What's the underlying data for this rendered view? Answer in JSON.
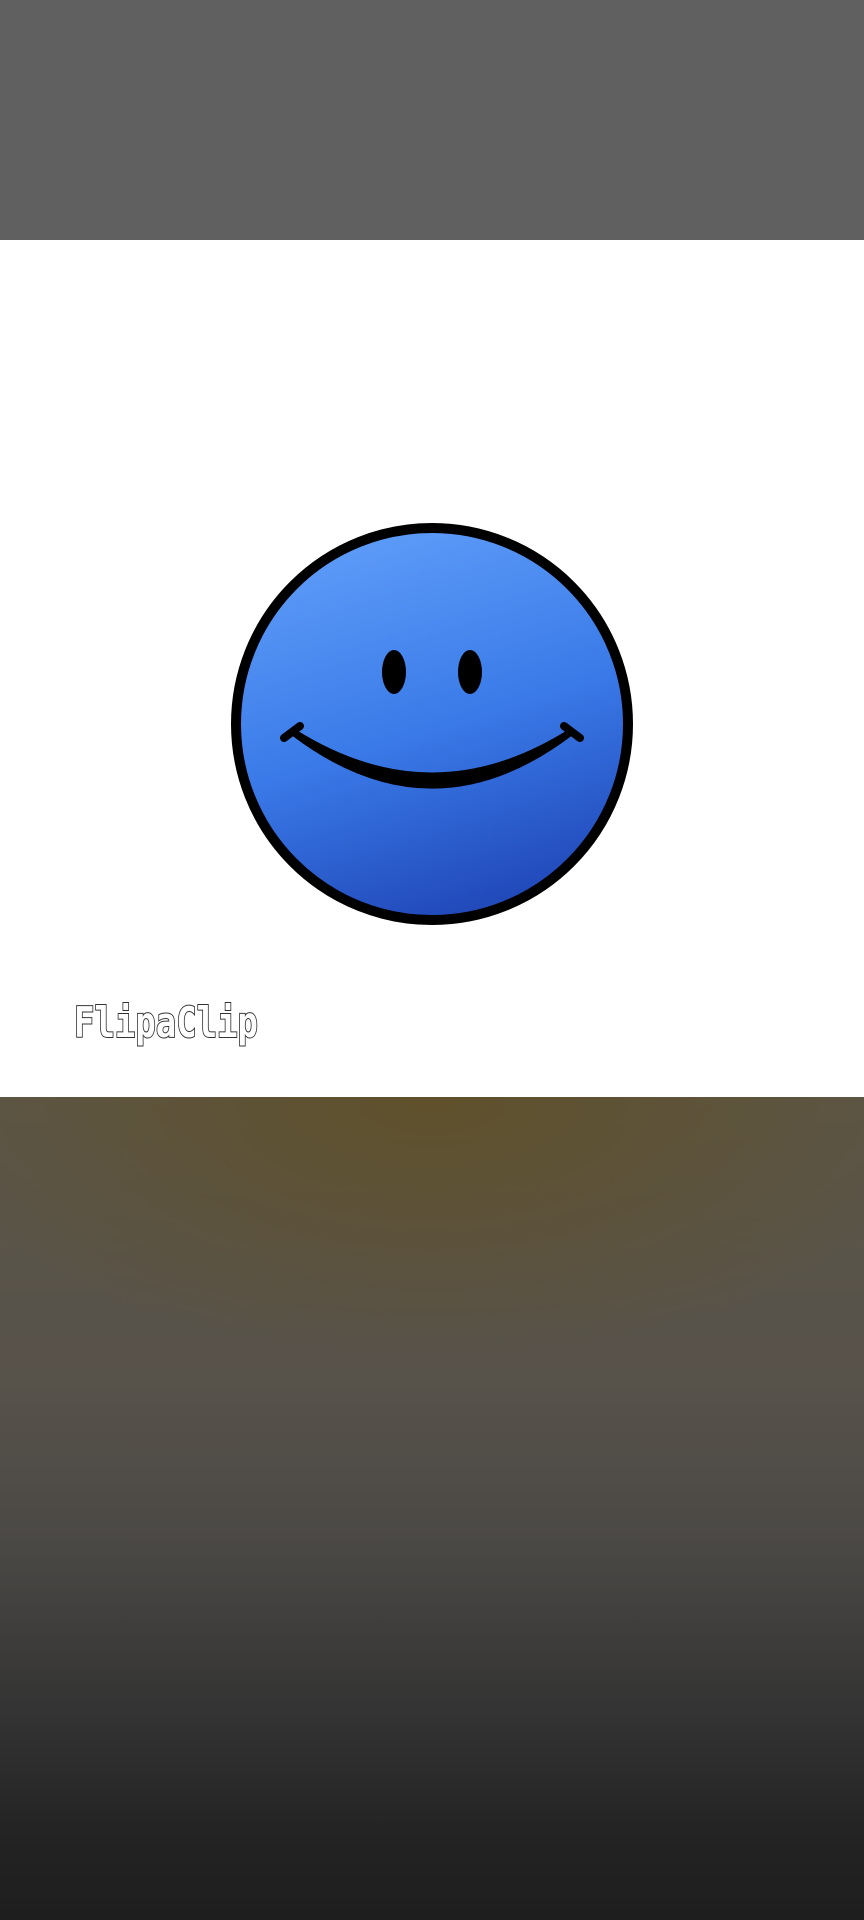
{
  "watermark": {
    "text": "FlipaClip"
  },
  "icons": {
    "smiley": "smiley-face-icon"
  },
  "colors": {
    "top_bar": "#606060",
    "frame_background": "#ffffff",
    "smiley_fill_light": "#5b9af7",
    "smiley_fill_dark": "#2047b8",
    "outline": "#000000",
    "bottom_top": "#5c5648",
    "bottom_bottom": "#1e1e1e"
  }
}
